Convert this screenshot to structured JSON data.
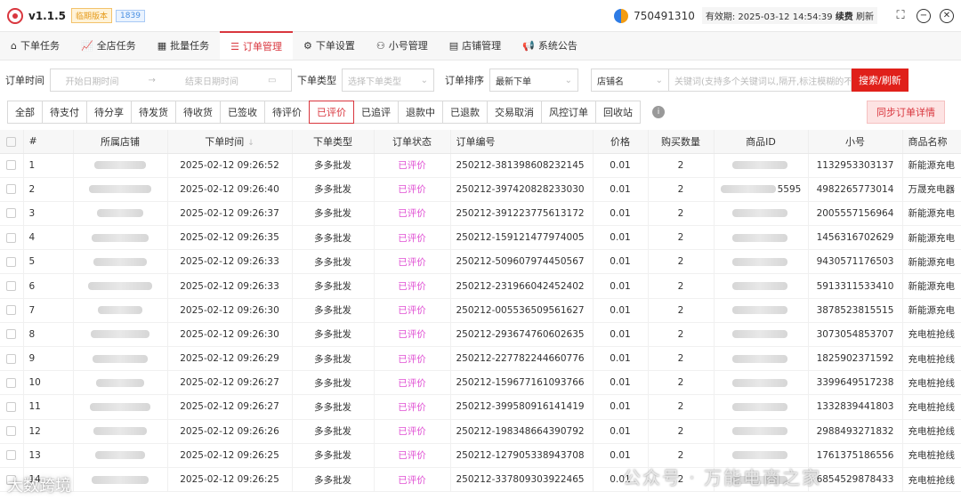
{
  "titlebar": {
    "version": "v1.1.5",
    "badge_plan": "临期版本",
    "badge_num": "1839",
    "user_id": "750491310",
    "expiry_label": "有效期:",
    "expiry_date": "2025-03-12 14:54:39",
    "renew": "续费",
    "refresh": "刷新"
  },
  "nav": {
    "tabs": [
      {
        "label": "下单任务",
        "icon": "home-icon"
      },
      {
        "label": "全店任务",
        "icon": "chart-icon"
      },
      {
        "label": "批量任务",
        "icon": "grid-icon"
      },
      {
        "label": "订单管理",
        "icon": "list-icon",
        "active": true
      },
      {
        "label": "下单设置",
        "icon": "gear-icon"
      },
      {
        "label": "小号管理",
        "icon": "users-icon"
      },
      {
        "label": "店铺管理",
        "icon": "store-icon"
      },
      {
        "label": "系统公告",
        "icon": "megaphone-icon"
      }
    ]
  },
  "filters": {
    "time_label": "订单时间",
    "start_placeholder": "开始日期时间",
    "end_placeholder": "结束日期时间",
    "type_label": "下单类型",
    "type_placeholder": "选择下单类型",
    "sort_label": "订单排序",
    "sort_value": "最新下单",
    "shop_placeholder": "店铺名",
    "search_placeholder": "关键词(支持多个关键词以,隔开,标注模糊的不",
    "search_button": "搜索/刷新"
  },
  "status_tabs": [
    "全部",
    "待支付",
    "待分享",
    "待发货",
    "待收货",
    "已签收",
    "待评价",
    "已评价",
    "已追评",
    "退款中",
    "已退款",
    "交易取消",
    "风控订单",
    "回收站"
  ],
  "active_status": "已评价",
  "sync_button": "同步订单详情",
  "table": {
    "headers": [
      "#",
      "所属店铺",
      "下单时间",
      "下单类型",
      "订单状态",
      "订单编号",
      "价格",
      "购买数量",
      "商品ID",
      "小号",
      "商品名称"
    ],
    "rows": [
      {
        "n": "1",
        "time": "2025-02-12 09:26:52",
        "type": "多多批发",
        "status": "已评价",
        "order": "250212-381398608232145",
        "price": "0.01",
        "qty": "2",
        "sid": "",
        "acct": "1132953303137",
        "name": "新能源充电"
      },
      {
        "n": "2",
        "time": "2025-02-12 09:26:40",
        "type": "多多批发",
        "status": "已评价",
        "order": "250212-397420828233030",
        "price": "0.01",
        "qty": "2",
        "sid": "5595",
        "acct": "4982265773014",
        "name": "万晟充电器"
      },
      {
        "n": "3",
        "time": "2025-02-12 09:26:37",
        "type": "多多批发",
        "status": "已评价",
        "order": "250212-391223775613172",
        "price": "0.01",
        "qty": "2",
        "sid": "",
        "acct": "2005557156964",
        "name": "新能源充电"
      },
      {
        "n": "4",
        "time": "2025-02-12 09:26:35",
        "type": "多多批发",
        "status": "已评价",
        "order": "250212-159121477974005",
        "price": "0.01",
        "qty": "2",
        "sid": "",
        "acct": "1456316702629",
        "name": "新能源充电"
      },
      {
        "n": "5",
        "time": "2025-02-12 09:26:33",
        "type": "多多批发",
        "status": "已评价",
        "order": "250212-509607974450567",
        "price": "0.01",
        "qty": "2",
        "sid": "",
        "acct": "9430571176503",
        "name": "新能源充电"
      },
      {
        "n": "6",
        "time": "2025-02-12 09:26:33",
        "type": "多多批发",
        "status": "已评价",
        "order": "250212-231966042452402",
        "price": "0.01",
        "qty": "2",
        "sid": "",
        "acct": "5913311533410",
        "name": "新能源充电"
      },
      {
        "n": "7",
        "time": "2025-02-12 09:26:30",
        "type": "多多批发",
        "status": "已评价",
        "order": "250212-005536509561627",
        "price": "0.01",
        "qty": "2",
        "sid": "",
        "acct": "3878523815515",
        "name": "新能源充电"
      },
      {
        "n": "8",
        "time": "2025-02-12 09:26:30",
        "type": "多多批发",
        "status": "已评价",
        "order": "250212-293674760602635",
        "price": "0.01",
        "qty": "2",
        "sid": "",
        "acct": "3073054853707",
        "name": "充电桩抢线"
      },
      {
        "n": "9",
        "time": "2025-02-12 09:26:29",
        "type": "多多批发",
        "status": "已评价",
        "order": "250212-227782244660776",
        "price": "0.01",
        "qty": "2",
        "sid": "",
        "acct": "1825902371592",
        "name": "充电桩抢线"
      },
      {
        "n": "10",
        "time": "2025-02-12 09:26:27",
        "type": "多多批发",
        "status": "已评价",
        "order": "250212-159677161093766",
        "price": "0.01",
        "qty": "2",
        "sid": "",
        "acct": "3399649517238",
        "name": "充电桩抢线"
      },
      {
        "n": "11",
        "time": "2025-02-12 09:26:27",
        "type": "多多批发",
        "status": "已评价",
        "order": "250212-399580916141419",
        "price": "0.01",
        "qty": "2",
        "sid": "",
        "acct": "1332839441803",
        "name": "充电桩抢线"
      },
      {
        "n": "12",
        "time": "2025-02-12 09:26:26",
        "type": "多多批发",
        "status": "已评价",
        "order": "250212-198348664390792",
        "price": "0.01",
        "qty": "2",
        "sid": "",
        "acct": "2988493271832",
        "name": "充电桩抢线"
      },
      {
        "n": "13",
        "time": "2025-02-12 09:26:25",
        "type": "多多批发",
        "status": "已评价",
        "order": "250212-127905338943708",
        "price": "0.01",
        "qty": "2",
        "sid": "",
        "acct": "1761375186556",
        "name": "充电桩抢线"
      },
      {
        "n": "14",
        "time": "2025-02-12 09:26:25",
        "type": "多多批发",
        "status": "已评价",
        "order": "250212-337809303922465",
        "price": "0.01",
        "qty": "2",
        "sid": "",
        "acct": "6854529878433",
        "name": "充电桩抢线"
      }
    ]
  },
  "watermarks": {
    "left": "大数跨境",
    "right": "公众号 · 万能电商之家"
  }
}
